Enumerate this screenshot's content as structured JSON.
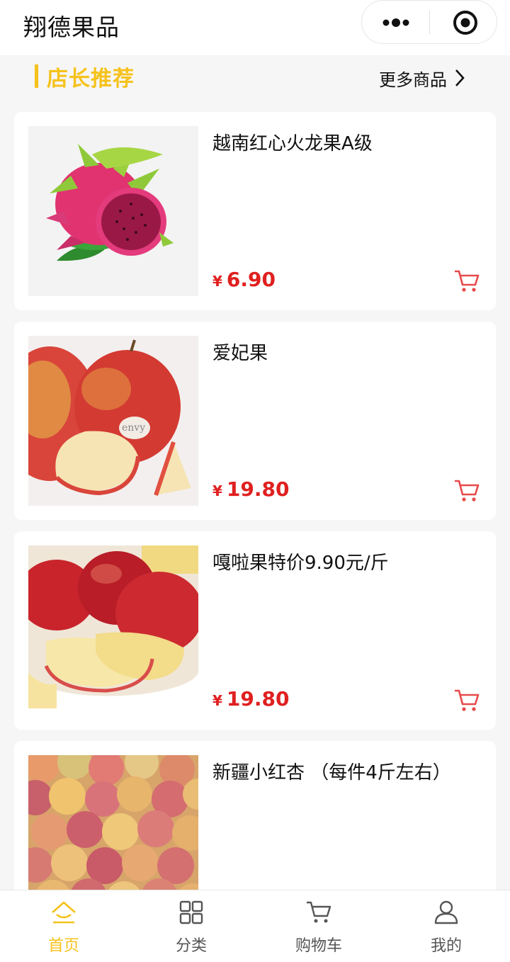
{
  "app": {
    "title": "翔德果品"
  },
  "section": {
    "title": "店长推荐",
    "more_label": "更多商品"
  },
  "products": [
    {
      "name": "越南红心火龙果A级",
      "currency": "¥",
      "price": "6.90",
      "image": "dragon-fruit"
    },
    {
      "name": "爱妃果",
      "currency": "¥",
      "price": "19.80",
      "image": "envy-apple"
    },
    {
      "name": "嘎啦果特价9.90元/斤",
      "currency": "¥",
      "price": "19.80",
      "image": "gala-apple"
    },
    {
      "name": "新疆小红杏 （每件4斤左右）",
      "currency": "¥",
      "price": "",
      "image": "apricots"
    }
  ],
  "tabs": [
    {
      "label": "首页",
      "icon": "home-icon",
      "active": true
    },
    {
      "label": "分类",
      "icon": "grid-icon",
      "active": false
    },
    {
      "label": "购物车",
      "icon": "cart-icon",
      "active": false
    },
    {
      "label": "我的",
      "icon": "user-icon",
      "active": false
    }
  ],
  "colors": {
    "accent": "#f6c21b",
    "price": "#e02020",
    "cart_icon": "#e84a4a"
  }
}
